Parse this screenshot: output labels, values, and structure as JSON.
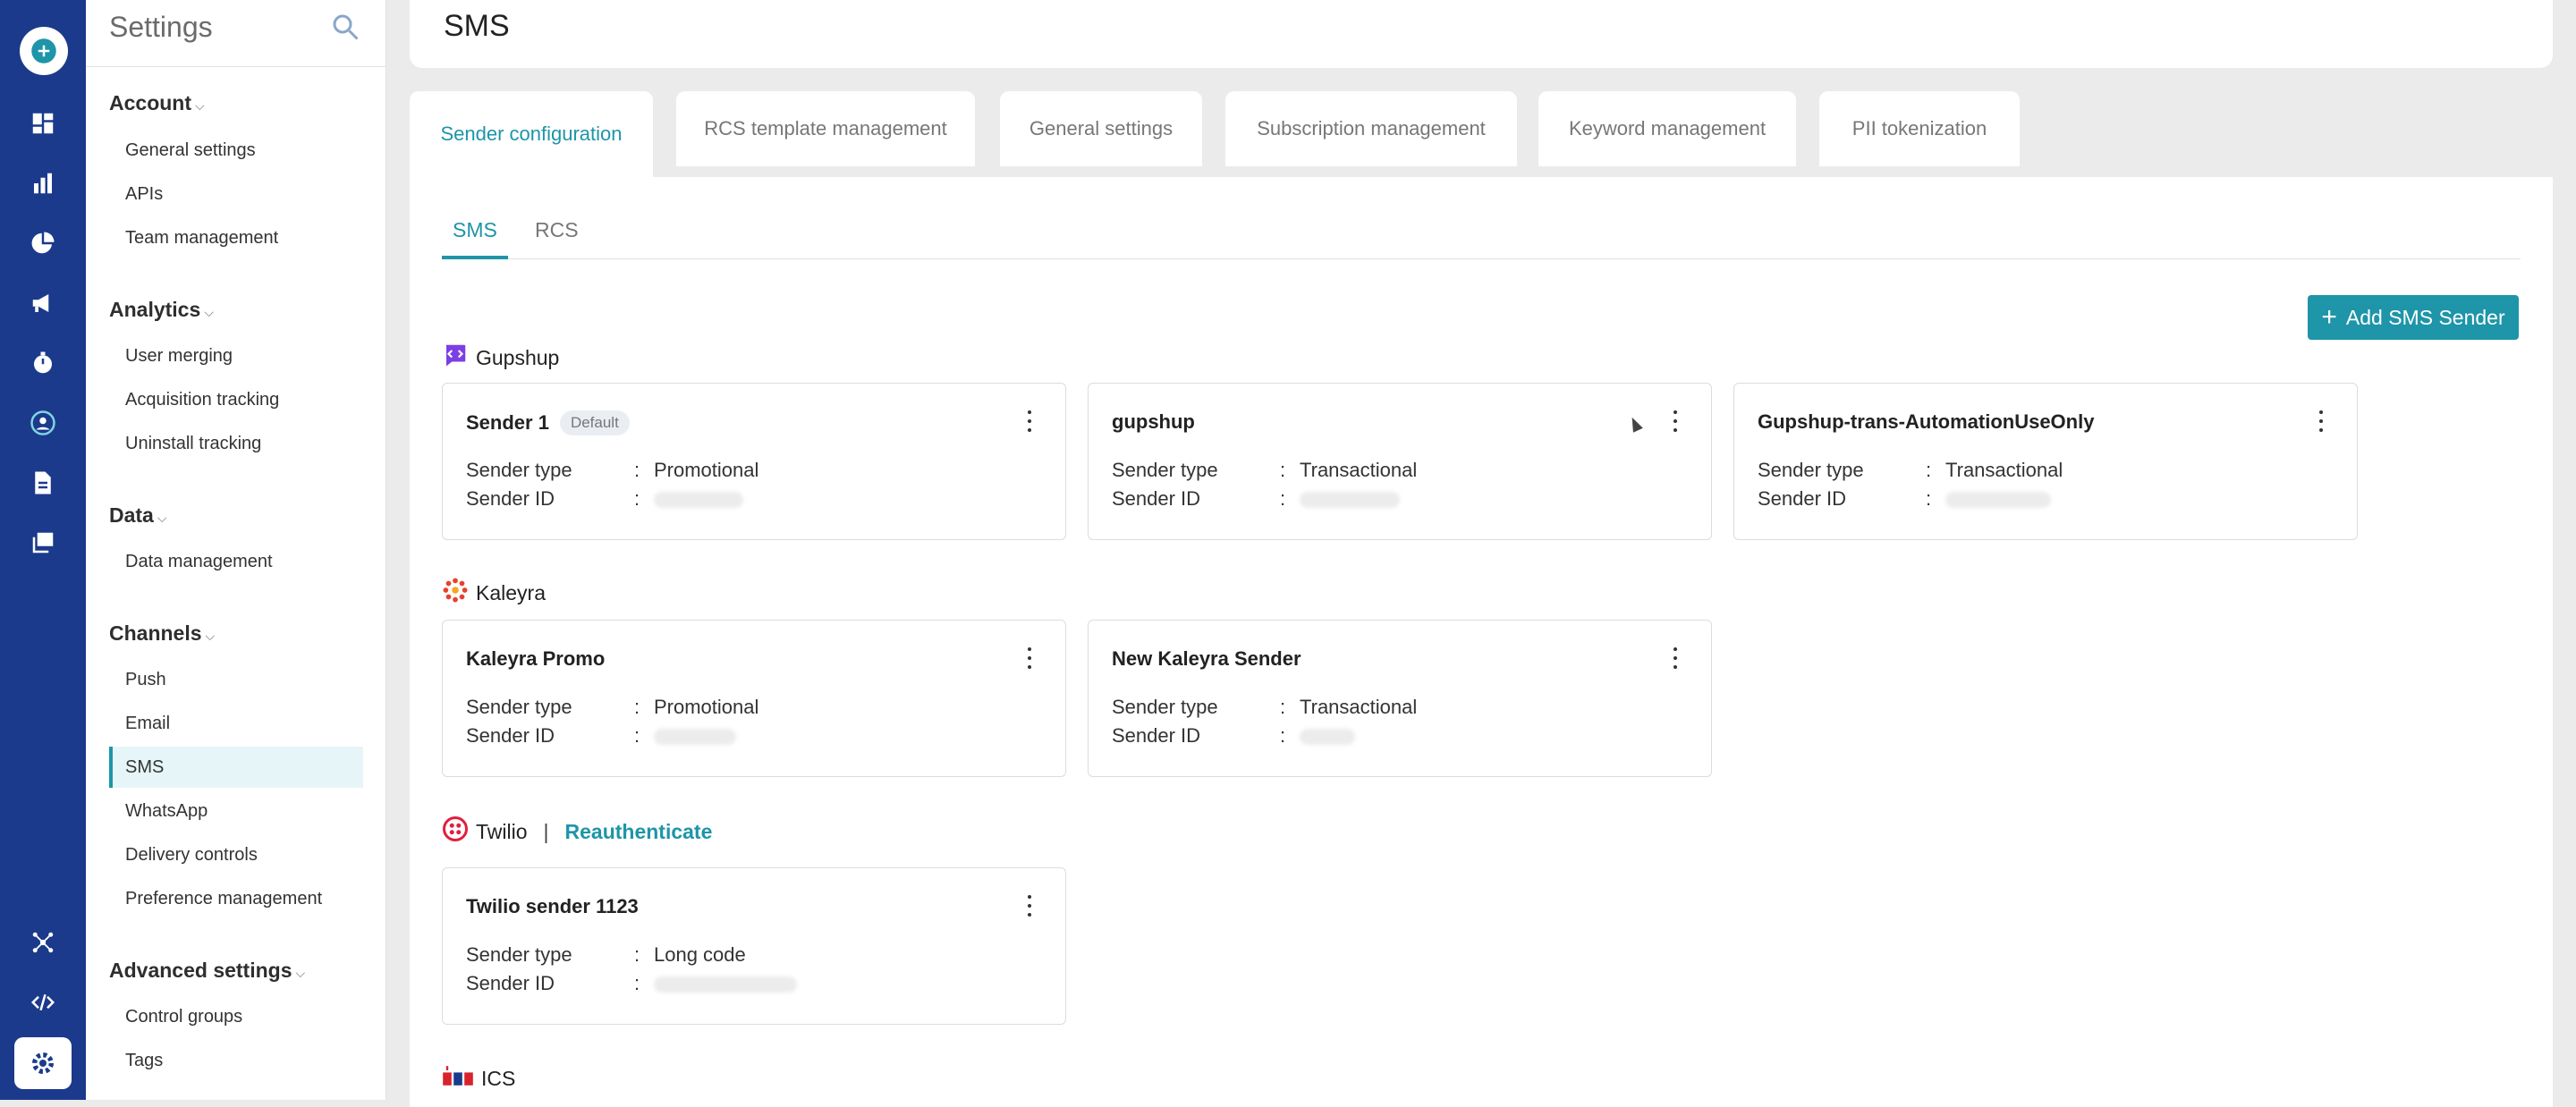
{
  "sidebar": {
    "title": "Settings",
    "groups": [
      {
        "label": "Account",
        "items": [
          "General settings",
          "APIs",
          "Team management"
        ]
      },
      {
        "label": "Analytics",
        "items": [
          "User merging",
          "Acquisition tracking",
          "Uninstall tracking"
        ]
      },
      {
        "label": "Data",
        "items": [
          "Data management"
        ]
      },
      {
        "label": "Channels",
        "items": [
          "Push",
          "Email",
          "SMS",
          "WhatsApp",
          "Delivery controls",
          "Preference management"
        ]
      },
      {
        "label": "Advanced settings",
        "items": [
          "Control groups",
          "Tags"
        ]
      }
    ],
    "active_item": "SMS"
  },
  "header": {
    "title": "SMS"
  },
  "tabs": [
    {
      "label": "Sender configuration",
      "active": true
    },
    {
      "label": "RCS template management"
    },
    {
      "label": "General settings"
    },
    {
      "label": "Subscription management"
    },
    {
      "label": "Keyword management"
    },
    {
      "label": "PII tokenization"
    }
  ],
  "subtabs": [
    {
      "label": "SMS",
      "active": true
    },
    {
      "label": "RCS"
    }
  ],
  "add_button": {
    "label": "Add SMS Sender"
  },
  "labels": {
    "sender_type": "Sender type",
    "sender_id": "Sender ID",
    "colon": ":",
    "default_badge": "Default"
  },
  "providers": [
    {
      "name": "Gupshup",
      "icon": "gupshup-logo-icon",
      "senders": [
        {
          "name": "Sender 1",
          "default": true,
          "sender_type": "Promotional"
        },
        {
          "name": "gupshup",
          "sender_type": "Transactional"
        },
        {
          "name": "Gupshup-trans-AutomationUseOnly",
          "sender_type": "Transactional"
        }
      ]
    },
    {
      "name": "Kaleyra",
      "icon": "kaleyra-logo-icon",
      "senders": [
        {
          "name": "Kaleyra Promo",
          "sender_type": "Promotional"
        },
        {
          "name": "New Kaleyra Sender",
          "sender_type": "Transactional"
        }
      ]
    },
    {
      "name": "Twilio",
      "icon": "twilio-logo-icon",
      "separator": "|",
      "action": "Reauthenticate",
      "senders": [
        {
          "name": "Twilio sender 1123",
          "sender_type": "Long code"
        }
      ]
    },
    {
      "name": "ICS",
      "icon": "ics-logo-icon",
      "senders": []
    }
  ],
  "colors": {
    "rail": "#1b3a8c",
    "accent": "#1e95a8",
    "background": "#ebebeb"
  }
}
